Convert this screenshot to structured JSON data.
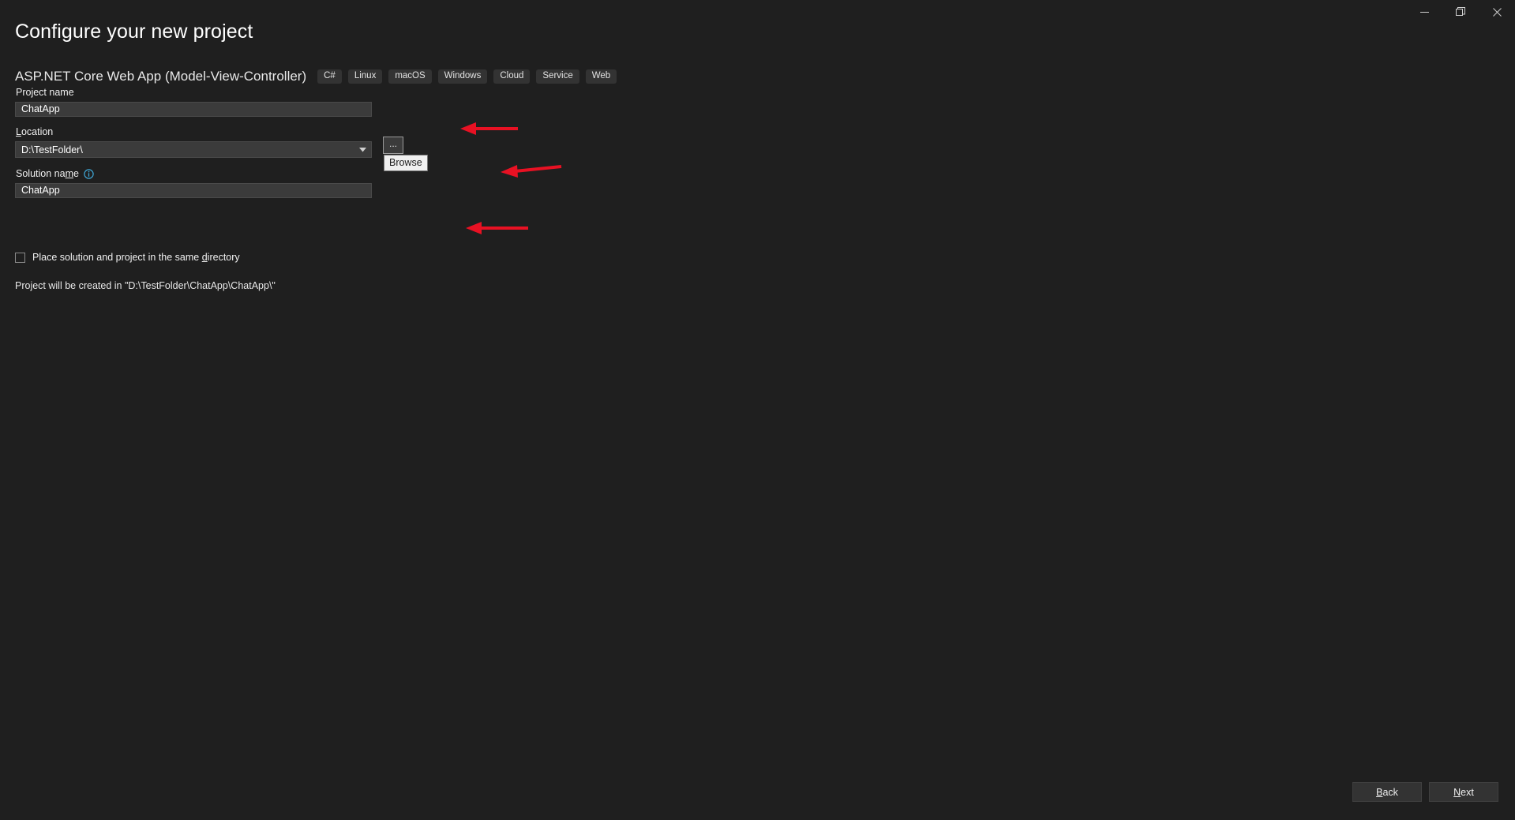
{
  "window": {
    "controls": [
      {
        "name": "minimize",
        "glyph": "minimize-icon"
      },
      {
        "name": "restore",
        "glyph": "restore-icon"
      },
      {
        "name": "close",
        "glyph": "close-icon"
      }
    ]
  },
  "header": {
    "title": "Configure your new project",
    "template_name": "ASP.NET Core Web App (Model-View-Controller)",
    "tags": [
      "C#",
      "Linux",
      "macOS",
      "Windows",
      "Cloud",
      "Service",
      "Web"
    ]
  },
  "form": {
    "project_name": {
      "label": "Project name",
      "value": "ChatApp",
      "placeholder": ""
    },
    "location": {
      "label_prefix": "",
      "label_accel": "L",
      "label_suffix": "ocation",
      "value": "D:\\TestFolder\\",
      "dropdown_icon": "chevron-down-icon"
    },
    "browse": {
      "button_label": "...",
      "tooltip": "Browse"
    },
    "solution_name": {
      "label_pre": "Solution na",
      "label_accel": "m",
      "label_post": "e",
      "value": "ChatApp",
      "info_icon": "info-icon"
    },
    "same_directory_checkbox": {
      "label_pre": "Place solution and project in the same ",
      "label_accel": "d",
      "label_post": "irectory",
      "checked": false
    },
    "status": "Project will be created in \"D:\\TestFolder\\ChatApp\\ChatApp\\\""
  },
  "footer": {
    "back": {
      "accel": "B",
      "rest": "ack"
    },
    "next": {
      "accel": "N",
      "rest": "ext"
    }
  },
  "colors": {
    "background": "#1f1f1f",
    "input_fill": "#3b3b3b",
    "tag_fill": "#333333",
    "annotation_red": "#e81123",
    "info_blue": "#3fa7d6",
    "tooltip_fill": "#f0f0f0"
  }
}
